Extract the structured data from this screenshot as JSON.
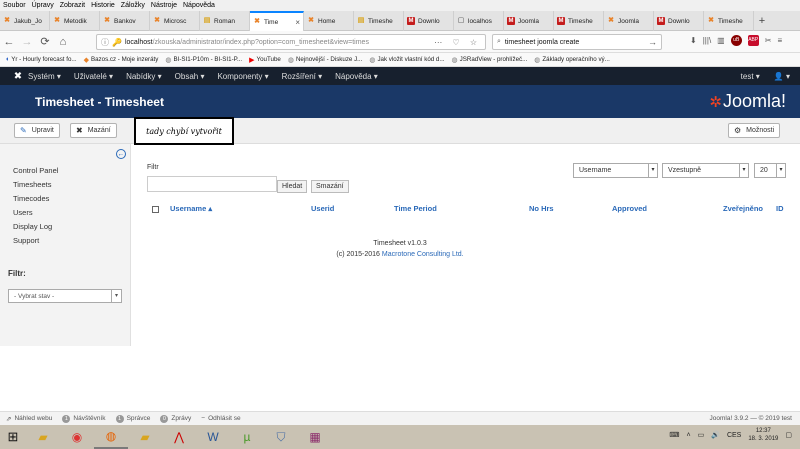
{
  "browser": {
    "menu": [
      "Soubor",
      "Úpravy",
      "Zobrazit",
      "Historie",
      "Záložky",
      "Nástroje",
      "Nápověda"
    ],
    "tabs": [
      {
        "label": "Jakub_Jo",
        "icon": "joomla-icon"
      },
      {
        "label": "Metodik",
        "icon": "joomla-icon"
      },
      {
        "label": "Bankov",
        "icon": "joomla-icon"
      },
      {
        "label": "Microsc",
        "icon": "joomla-icon"
      },
      {
        "label": "Roman",
        "icon": "doc-icon"
      },
      {
        "label": "Time",
        "icon": "joomla-icon",
        "active": true
      },
      {
        "label": "Home",
        "icon": "joomla-icon"
      },
      {
        "label": "Timeshe",
        "icon": "doc-icon"
      },
      {
        "label": "Downlo",
        "icon": "gmail-icon"
      },
      {
        "label": "localhos",
        "icon": "page-icon"
      },
      {
        "label": "Joomla",
        "icon": "gmail-icon"
      },
      {
        "label": "Timeshe",
        "icon": "gmail-icon"
      },
      {
        "label": "Joomla",
        "icon": "joomla-icon"
      },
      {
        "label": "Downlo",
        "icon": "gmail-icon"
      },
      {
        "label": "Timeshe",
        "icon": "joomla-icon"
      }
    ],
    "url_host": "localhost",
    "url_rest": "/zkouska/administrator/index.php?option=com_timesheet&view=times",
    "search_value": "timesheet joomla create",
    "bookmarks": [
      {
        "label": "Yr - Hourly forecast fo...",
        "icon": "bl"
      },
      {
        "label": "Bazos.cz - Moje inzeráty",
        "icon": "or"
      },
      {
        "label": "BI-SI1-P10m - BI-SI1-P...",
        "icon": "gr"
      },
      {
        "label": "YouTube",
        "icon": "yt"
      },
      {
        "label": "Nejnovější - Diskuze J...",
        "icon": "gr"
      },
      {
        "label": "Jak vložit vlastní kód d...",
        "icon": "gr"
      },
      {
        "label": "JSRadView - prohlížeč...",
        "icon": "gr"
      },
      {
        "label": "Základy operačního vý...",
        "icon": "gr"
      }
    ]
  },
  "joomla": {
    "nav": [
      "Systém ▾",
      "Uživatelé ▾",
      "Nabídky ▾",
      "Obsah ▾",
      "Komponenty ▾",
      "Rozšíření ▾",
      "Nápověda ▾"
    ],
    "nav_user": "test ▾",
    "nav_person": "👤 ▾",
    "page_title": "Timesheet - Timesheet",
    "brand": "Joomla!",
    "toolbar": {
      "edit": "Upravit",
      "delete": "Mazání",
      "options": "Možnosti"
    },
    "annotation": "tady chybí vytvořit"
  },
  "sidebar": {
    "links": [
      "Control Panel",
      "Timesheets",
      "Timecodes",
      "Users",
      "Display Log",
      "Support"
    ],
    "filter_label": "Filtr:",
    "state_select": "- Vybrat stav -"
  },
  "main": {
    "filter_label": "Filtr",
    "search_button": "Hledat",
    "clear_button": "Smazání",
    "order_by": "Username",
    "direction": "Vzestupně",
    "limit": "20",
    "columns": [
      "Username ▴",
      "Userid",
      "Time Period",
      "No Hrs",
      "Approved",
      "Zveřejněno",
      "ID"
    ],
    "footer_version": "Timesheet v1.0.3",
    "footer_copy": "(c) 2015-2016",
    "footer_link": "Macrotone Consulting Ltd."
  },
  "status": {
    "view_site": "Náhled webu",
    "visitors_count": "1",
    "visitors": "Návštěvník",
    "admins_count": "1",
    "admins": "Správce",
    "messages_count": "0",
    "messages": "Zprávy",
    "logout": "Odhlásit se",
    "version": "Joomla! 3.9.2 — © 2019 test"
  },
  "taskbar": {
    "lang": "CES",
    "time": "12:37",
    "date": "18. 3. 2019"
  }
}
